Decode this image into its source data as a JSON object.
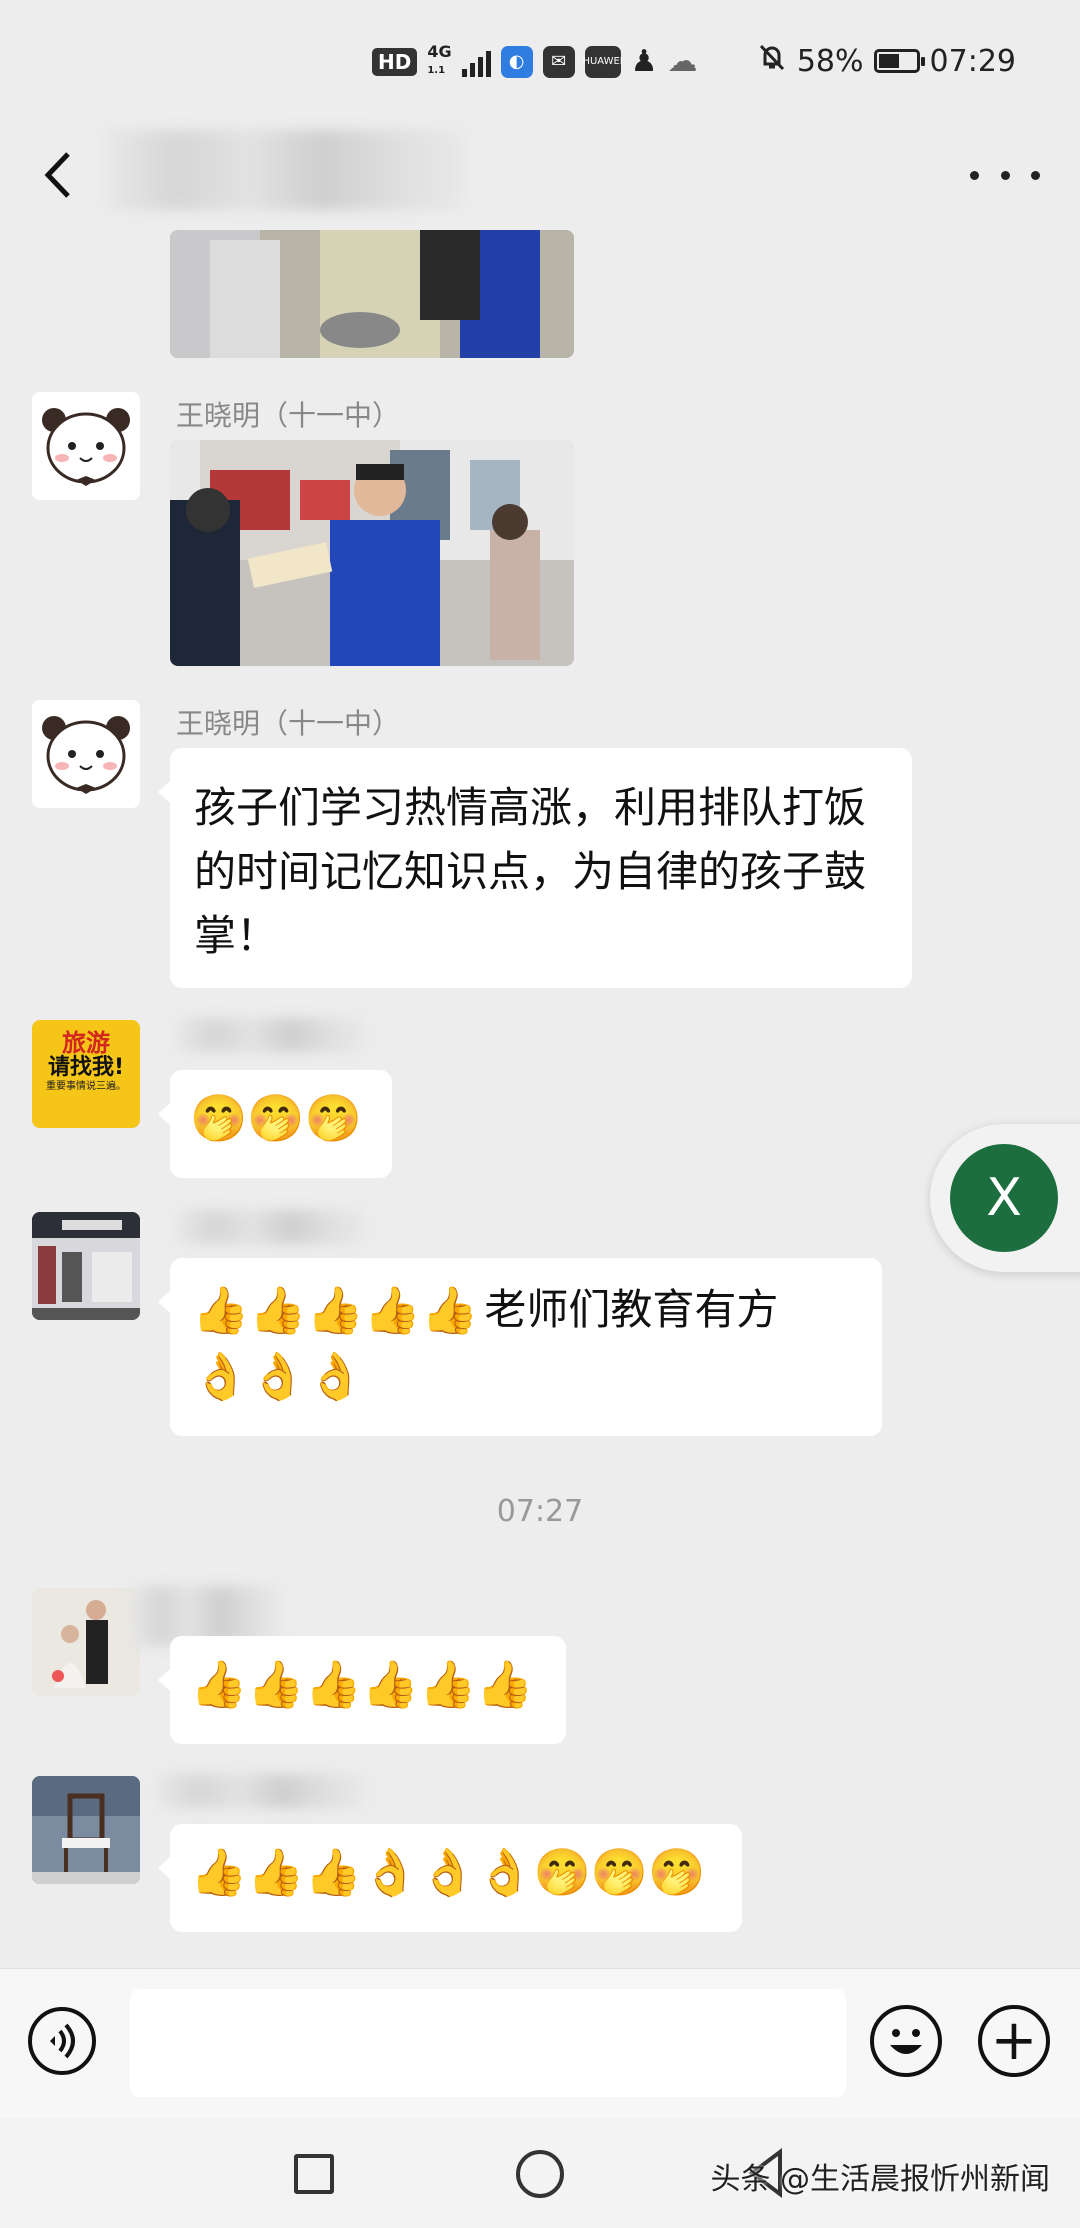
{
  "status_bar": {
    "hd": "HD",
    "network": "4G",
    "network_sub": "1.1",
    "app_badge_small": "HUAWEI",
    "battery": "58%",
    "battery_level": 0.58,
    "time": "07:29"
  },
  "header": {
    "more": "…"
  },
  "messages": [
    {
      "sender": "王晓明（十一中）"
    },
    {
      "sender": "王晓明（十一中）",
      "text": "孩子们学习热情高涨，利用排队打饭的时间记忆知识点，为自律的孩子鼓掌！"
    },
    {
      "emoji": "🤭🤭🤭",
      "avatar_text_1": "旅游",
      "avatar_text_2": "请找我!",
      "avatar_text_3": "重要事情说三遍。"
    },
    {
      "emoji": "👍👍👍👍👍",
      "text": "老师们教育有方",
      "emoji_after": "👌👌👌"
    },
    {
      "emoji": "👍👍👍👍👍👍"
    },
    {
      "emoji": "👍👍👍👌👌👌🤭🤭🤭"
    }
  ],
  "time_divider": "07:27",
  "floating_button": "X",
  "input": {
    "plus": "+"
  },
  "watermark": "头条 @生活晨报忻州新闻"
}
